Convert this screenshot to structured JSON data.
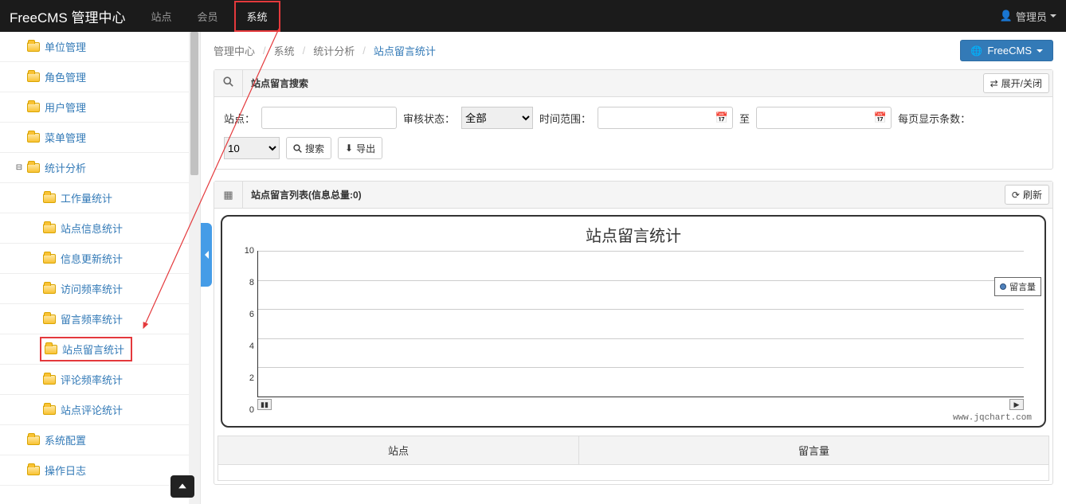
{
  "brand": "FreeCMS 管理中心",
  "nav": {
    "site": "站点",
    "member": "会员",
    "system": "系统"
  },
  "user": {
    "label": "管理员"
  },
  "sidebar": {
    "items": [
      {
        "label": "单位管理",
        "level": 1
      },
      {
        "label": "角色管理",
        "level": 1
      },
      {
        "label": "用户管理",
        "level": 1
      },
      {
        "label": "菜单管理",
        "level": 1
      },
      {
        "label": "统计分析",
        "level": 1,
        "expanded": true
      },
      {
        "label": "工作量统计",
        "level": 2
      },
      {
        "label": "站点信息统计",
        "level": 2
      },
      {
        "label": "信息更新统计",
        "level": 2
      },
      {
        "label": "访问频率统计",
        "level": 2
      },
      {
        "label": "留言频率统计",
        "level": 2
      },
      {
        "label": "站点留言统计",
        "level": 2,
        "active": true
      },
      {
        "label": "评论频率统计",
        "level": 2
      },
      {
        "label": "站点评论统计",
        "level": 2
      },
      {
        "label": "系统配置",
        "level": 1
      },
      {
        "label": "操作日志",
        "level": 1
      }
    ]
  },
  "breadcrumb": {
    "a": "管理中心",
    "b": "系统",
    "c": "统计分析",
    "d": "站点留言统计"
  },
  "freecms_btn": "FreeCMS",
  "search_panel": {
    "title": "站点留言搜索",
    "toggle": "展开/关闭",
    "site_label": "站点：",
    "status_label": "审核状态：",
    "status_value": "全部",
    "time_label": "时间范围：",
    "to_label": "至",
    "pagesize_label": "每页显示条数：",
    "pagesize_value": "10",
    "search_btn": "搜索",
    "export_btn": "导出"
  },
  "list_panel": {
    "title": "站点留言列表(信息总量:0)",
    "refresh": "刷新"
  },
  "chart_data": {
    "type": "bar",
    "title": "站点留言统计",
    "categories": [],
    "series": [
      {
        "name": "留言量",
        "values": []
      }
    ],
    "ylim": [
      0,
      10
    ],
    "yticks": [
      0,
      2,
      4,
      6,
      8,
      10
    ],
    "credit": "www.jqchart.com"
  },
  "table": {
    "col1": "站点",
    "col2": "留言量"
  }
}
